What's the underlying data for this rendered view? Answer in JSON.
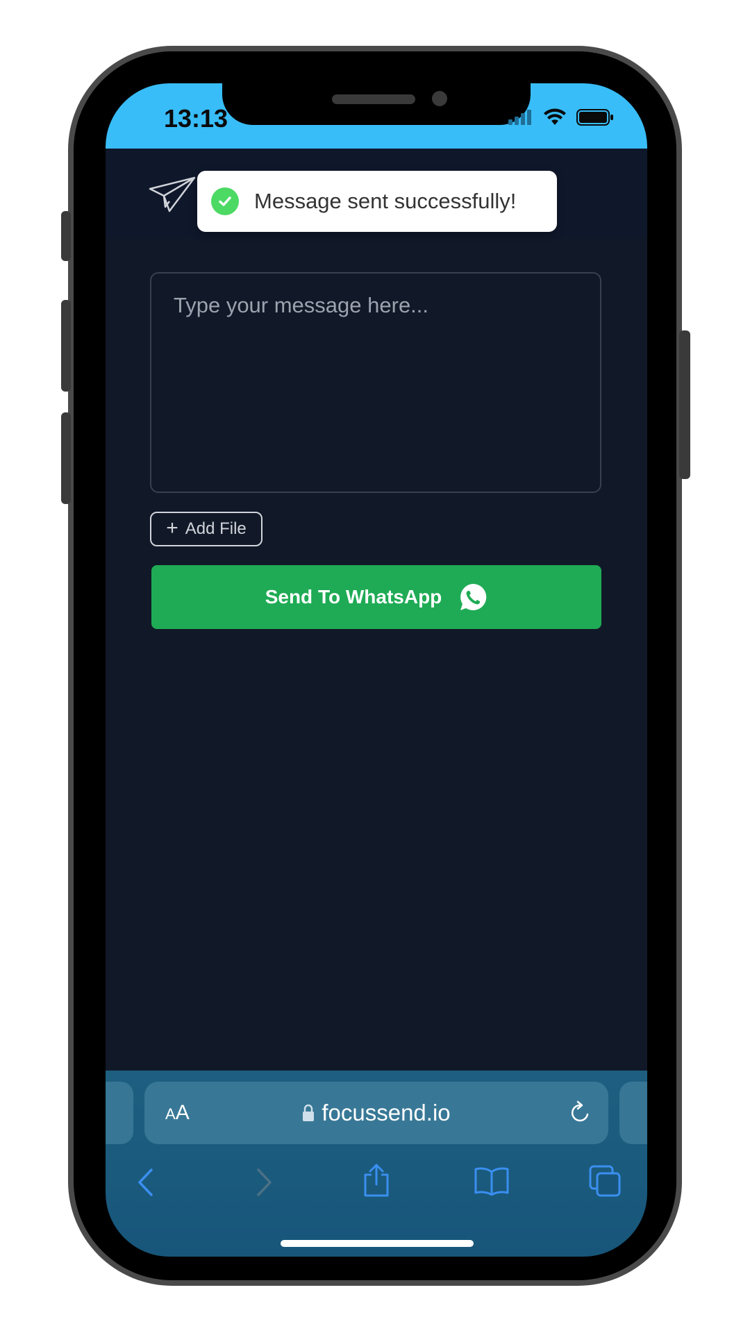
{
  "status_bar": {
    "time": "13:13"
  },
  "toast": {
    "message": "Message sent successfully!"
  },
  "composer": {
    "placeholder": "Type your message here...",
    "value": ""
  },
  "add_file": {
    "label": "Add File"
  },
  "send_button": {
    "label": "Send To WhatsApp"
  },
  "browser": {
    "text_size_label_small": "A",
    "text_size_label_large": "A",
    "url": "focussend.io"
  },
  "colors": {
    "status_bar": "#38bdf8",
    "background": "#111827",
    "send_button": "#1fab55",
    "toast_check": "#4cd964"
  },
  "icons": {
    "logo": "paper-plane-icon",
    "toast": "check-circle-icon",
    "add_file": "plus-icon",
    "send": "whatsapp-icon",
    "lock": "lock-icon",
    "reload": "reload-icon",
    "toolbar": [
      "back-icon",
      "forward-icon",
      "share-icon",
      "bookmarks-icon",
      "tabs-icon"
    ]
  }
}
